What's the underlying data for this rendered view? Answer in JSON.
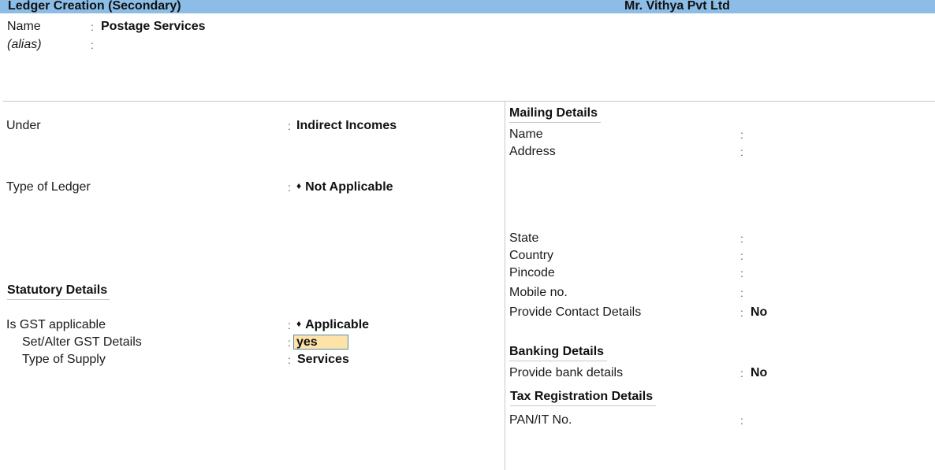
{
  "window": {
    "title": "Ledger Creation (Secondary)",
    "company": "Mr. Vithya Pvt Ltd"
  },
  "header": {
    "name_label": "Name",
    "name_value": "Postage Services",
    "alias_label": "(alias)",
    "alias_value": ""
  },
  "left": {
    "under_label": "Under",
    "under_value": "Indirect Incomes",
    "type_of_ledger_label": "Type of Ledger",
    "type_of_ledger_value": "Not Applicable",
    "statutory_heading": "Statutory Details",
    "gst_applicable_label": "Is GST applicable",
    "gst_applicable_value": "Applicable",
    "set_alter_gst_label": "Set/Alter GST Details",
    "set_alter_gst_value": "yes",
    "type_of_supply_label": "Type of Supply",
    "type_of_supply_value": "Services"
  },
  "right": {
    "mailing_heading": "Mailing Details",
    "mailing_name_label": "Name",
    "mailing_name_value": "",
    "address_label": "Address",
    "address_value": "",
    "state_label": "State",
    "state_value": "",
    "country_label": "Country",
    "country_value": "",
    "pincode_label": "Pincode",
    "pincode_value": "",
    "mobile_label": "Mobile no.",
    "mobile_value": "",
    "contact_label": "Provide Contact Details",
    "contact_value": "No",
    "banking_heading": "Banking Details",
    "bank_label": "Provide bank details",
    "bank_value": "No",
    "tax_heading": "Tax Registration Details",
    "pan_label": "PAN/IT No.",
    "pan_value": ""
  },
  "symbols": {
    "colon": ":",
    "diamond": "♦"
  },
  "colors": {
    "titlebar": "#8bbde6",
    "active_field": "#fde3a8"
  }
}
